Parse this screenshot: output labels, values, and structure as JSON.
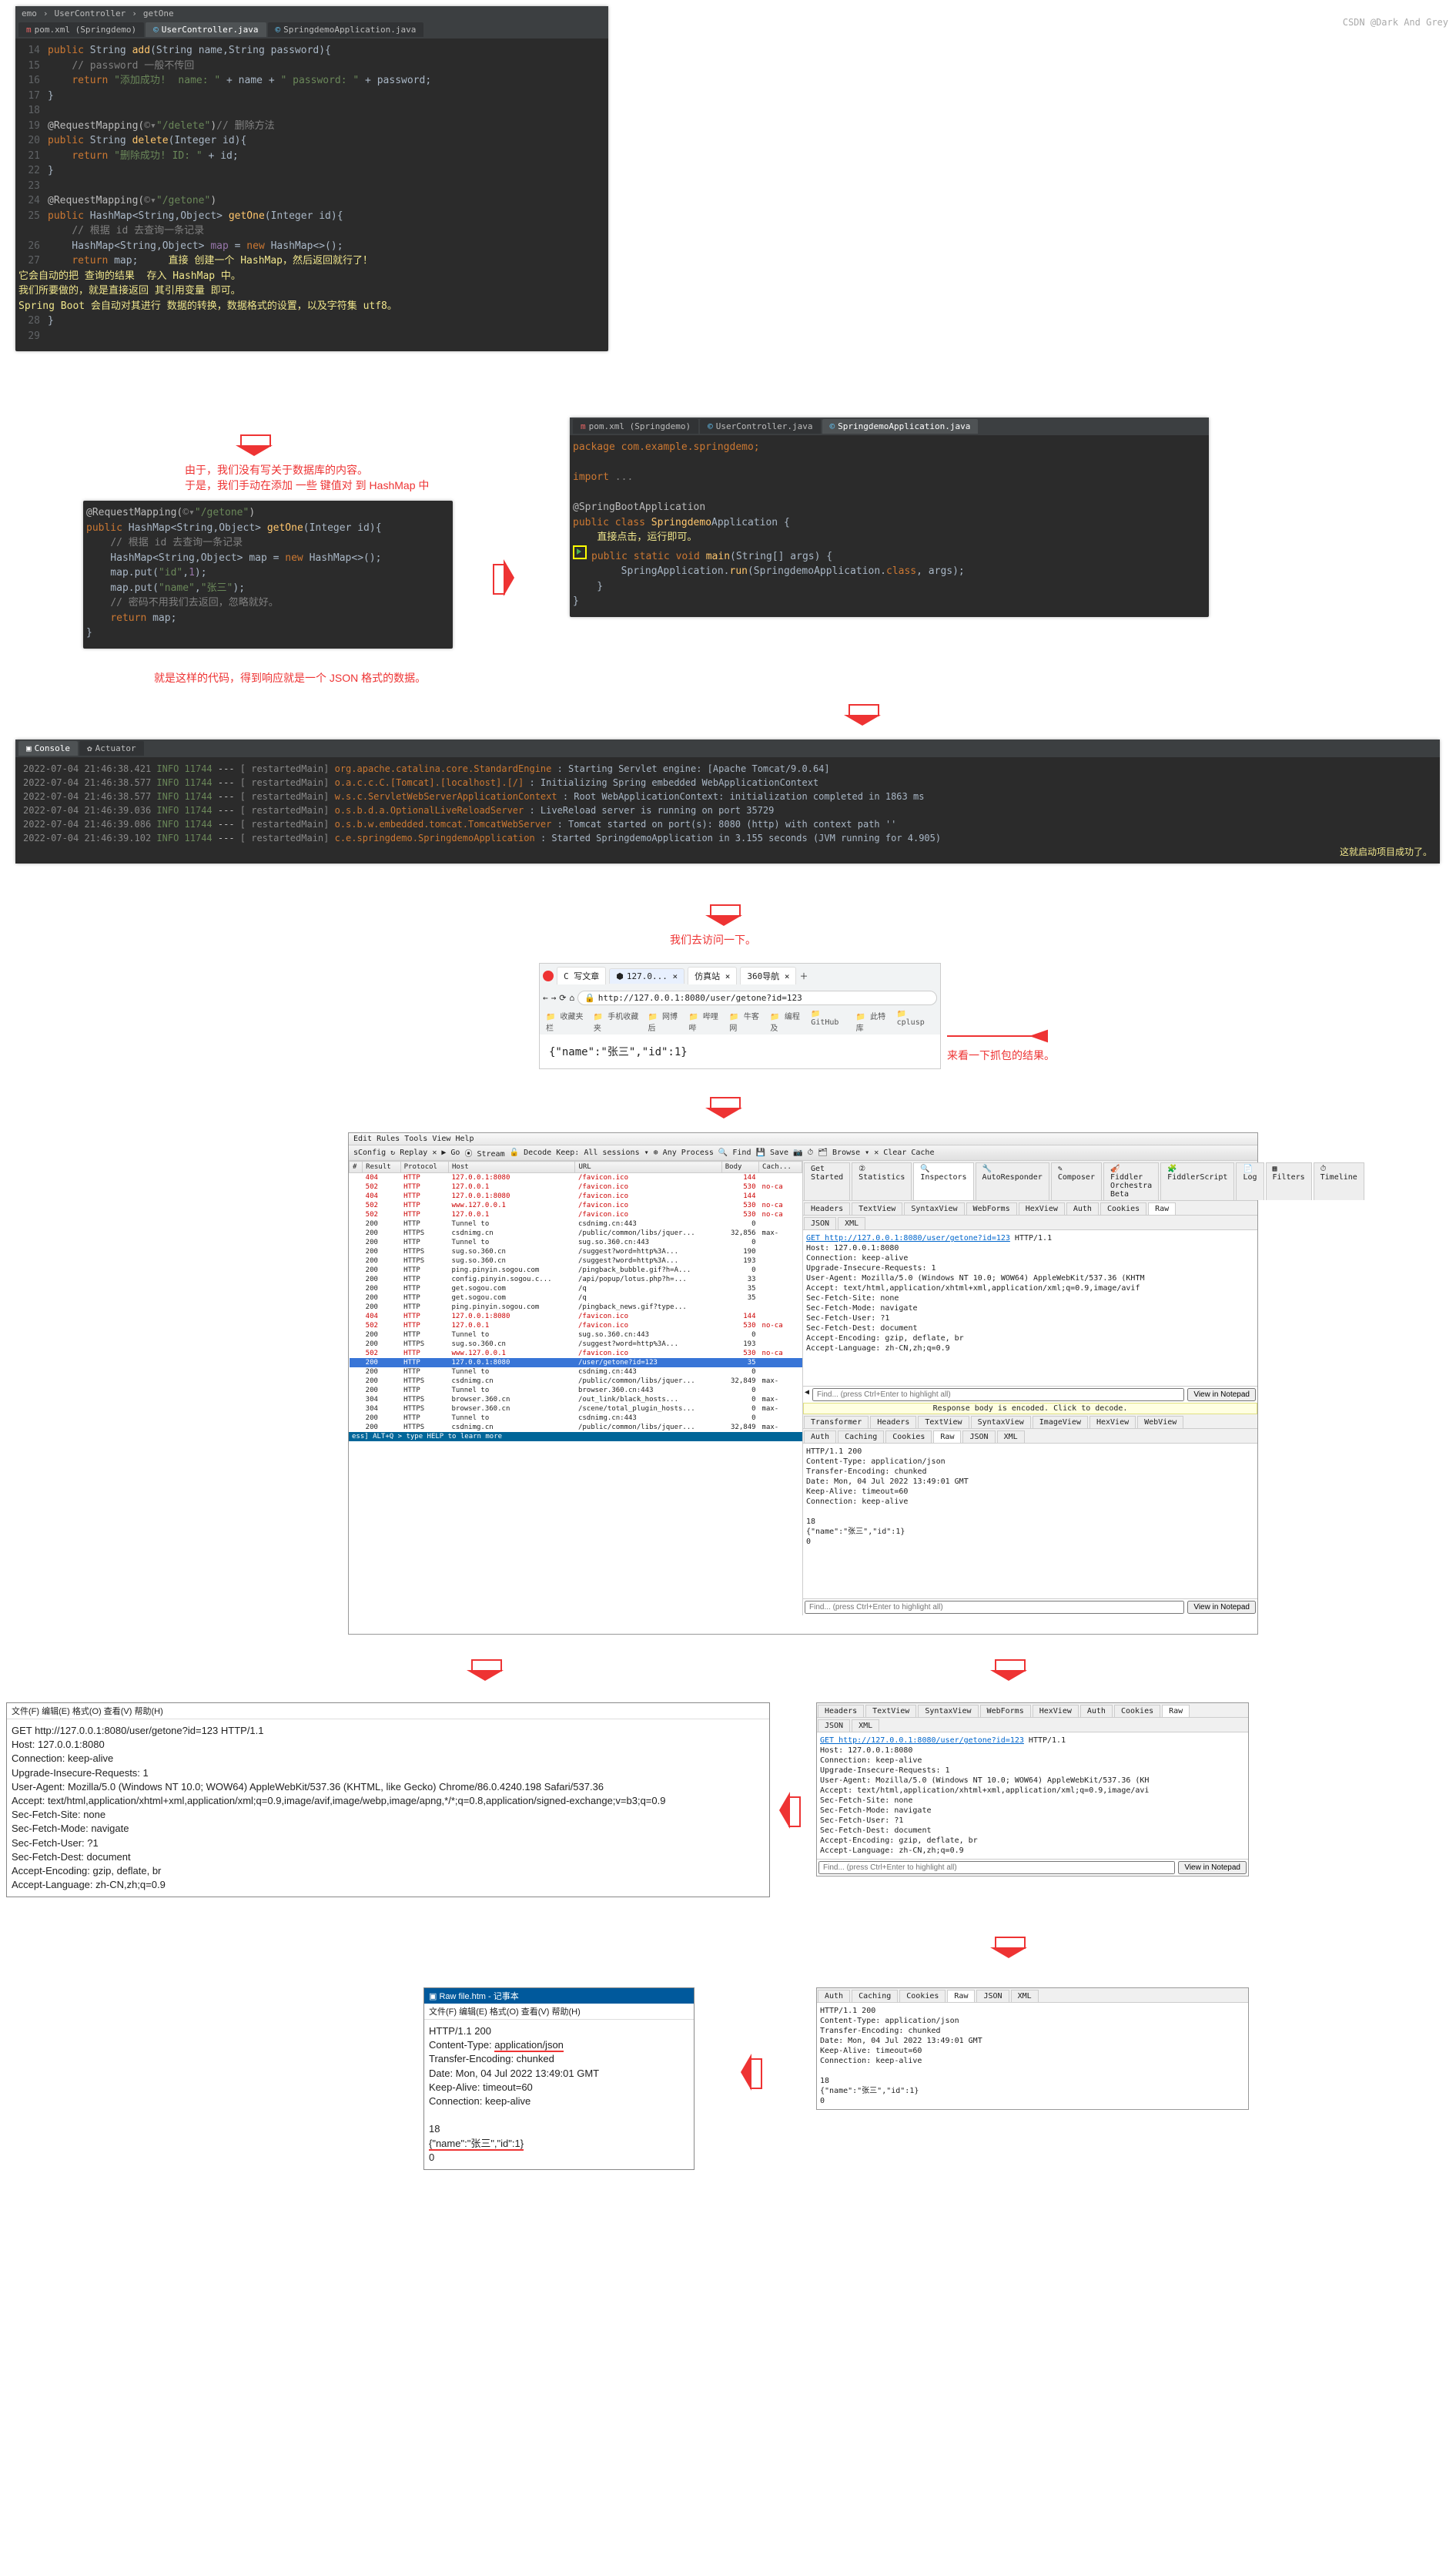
{
  "ide1": {
    "nav": [
      "emo",
      "UserController",
      "getOne"
    ],
    "tabs": [
      "pom.xml (Springdemo)",
      "UserController.java",
      "SpringdemoApplication.java"
    ],
    "lines": {
      "14": "    public String add(String name,String password){",
      "15": "        // password 一般不传回",
      "16": "        return \"添加成功!  name: \" + name + \" password: \" + password;",
      "17": "    }",
      "18": "",
      "19": "    @RequestMapping(©▾\"/delete\")// 删除方法",
      "20": "    public String delete(Integer id){",
      "21": "        return \"删除成功! ID: \" + id;",
      "22": "    }",
      "23": "",
      "24": "    @RequestMapping(©▾\"/getone\")",
      "25": "    public HashMap<String,Object> getOne(Integer id){",
      "25c": "        // 根据 id 去查询一条记录",
      "26": "        HashMap<String,Object> map = new HashMap<>();",
      "27": "        return map;",
      "28": "    }",
      "29": ""
    },
    "hint": "直接 创建一个 HashMap，然后返回就行了！\n它会自动的把 查询的结果  存入 HashMap 中。\n我们所要做的，就是直接返回 其引用变量 即可。\nSpring Boot 会自动对其进行 数据的转换，数据格式的设置，以及字符集 utf8。"
  },
  "note1": "由于，我们没有写关于数据库的内容。\n于是，我们手动在添加 一些 键值对 到 HashMap 中",
  "ide2": {
    "code": "@RequestMapping(©▾\"/getone\")\npublic HashMap<String,Object> getOne(Integer id){\n    // 根据 id 去查询一条记录\n    HashMap<String,Object> map = new HashMap<>();\n    map.put(\"id\",1);\n    map.put(\"name\",\"张三\");\n    // 密码不用我们去返回，忽略就好。\n    return map;\n}"
  },
  "note2": "就是这样的代码，得到响应就是一个 JSON 格式的数据。",
  "ide3": {
    "tabs": [
      "pom.xml (Springdemo)",
      "UserController.java",
      "SpringdemoApplication.java"
    ],
    "pkg": "package com.example.springdemo;",
    "imp": "import ...",
    "ann": "@SpringBootApplication",
    "cls": "public class SpringdemoApplication {",
    "hint": "直接点击，运行即可。",
    "main": "    public static void main(String[] args) {",
    "body": "        SpringApplication.run(SpringdemoApplication.class, args);",
    "end1": "    }",
    "end2": "}"
  },
  "console": {
    "tabs": [
      "Console",
      "Actuator"
    ],
    "rows": [
      {
        "ts": "2022-07-04 21:46:38.421",
        "lvl": "INFO 11744",
        "th": "[   restartedMain]",
        "cls": "org.apache.catalina.core.StandardEngine",
        "msg": ": Starting Servlet engine: [Apache Tomcat/9.0.64]"
      },
      {
        "ts": "2022-07-04 21:46:38.577",
        "lvl": "INFO 11744",
        "th": "[   restartedMain]",
        "cls": "o.a.c.c.C.[Tomcat].[localhost].[/]",
        "msg": ": Initializing Spring embedded WebApplicationContext"
      },
      {
        "ts": "2022-07-04 21:46:38.577",
        "lvl": "INFO 11744",
        "th": "[   restartedMain]",
        "cls": "w.s.c.ServletWebServerApplicationContext",
        "msg": ": Root WebApplicationContext: initialization completed in 1863 ms"
      },
      {
        "ts": "2022-07-04 21:46:39.036",
        "lvl": "INFO 11744",
        "th": "[   restartedMain]",
        "cls": "o.s.b.d.a.OptionalLiveReloadServer",
        "msg": ": LiveReload server is running on port 35729"
      },
      {
        "ts": "2022-07-04 21:46:39.086",
        "lvl": "INFO 11744",
        "th": "[   restartedMain]",
        "cls": "o.s.b.w.embedded.tomcat.TomcatWebServer",
        "msg": ": Tomcat started on port(s): 8080 (http) with context path ''"
      },
      {
        "ts": "2022-07-04 21:46:39.102",
        "lvl": "INFO 11744",
        "th": "[   restartedMain]",
        "cls": "c.e.springdemo.SpringdemoApplication",
        "msg": ": Started SpringdemoApplication in 3.155 seconds (JVM running for 4.905)"
      }
    ],
    "success": "这就启动项目成功了。"
  },
  "note3": "我们去访问一下。",
  "browser": {
    "tabs": [
      "C 写文章",
      "127.0... ×",
      "仿真站 ×",
      "360导航 ×"
    ],
    "url": "http://127.0.0.1:8080/user/getone?id=123",
    "bookmarks": [
      "收藏夹栏",
      "手机收藏夹",
      "网博后",
      "哔哩哔",
      "牛客网",
      "编程及",
      "GitHub",
      "此特库",
      "cplusp"
    ],
    "body": "{\"name\":\"张三\",\"id\":1}"
  },
  "note4": "来看一下抓包的结果。",
  "fiddler": {
    "menu": "Edit  Rules  Tools  View  Help",
    "tool": [
      "sConfig",
      "↻ Replay",
      "✕",
      "▶ Go",
      "⦿ Stream",
      "🔓 Decode",
      "Keep: All sessions ▾",
      "⊕ Any Process",
      "🔍 Find",
      "💾 Save",
      "📷",
      "⏱",
      "🗂 Browse ▾",
      "✕ Clear Cache"
    ],
    "cols": [
      "#",
      "Result",
      "Protocol",
      "Host",
      "URL",
      "Body",
      "Cach..."
    ],
    "rows": [
      {
        "n": "",
        "r": "404",
        "p": "HTTP",
        "h": "127.0.0.1:8080",
        "u": "/favicon.ico",
        "b": "144",
        "c": "",
        "err": true
      },
      {
        "n": "",
        "r": "502",
        "p": "HTTP",
        "h": "127.0.0.1",
        "u": "/favicon.ico",
        "b": "530",
        "c": "no-ca",
        "err": true
      },
      {
        "n": "",
        "r": "404",
        "p": "HTTP",
        "h": "127.0.0.1:8080",
        "u": "/favicon.ico",
        "b": "144",
        "c": "",
        "err": true
      },
      {
        "n": "",
        "r": "502",
        "p": "HTTP",
        "h": "www.127.0.0.1",
        "u": "/favicon.ico",
        "b": "530",
        "c": "no-ca",
        "err": true
      },
      {
        "n": "",
        "r": "502",
        "p": "HTTP",
        "h": "127.0.0.1",
        "u": "/favicon.ico",
        "b": "530",
        "c": "no-ca",
        "err": true
      },
      {
        "n": "",
        "r": "200",
        "p": "HTTP",
        "h": "Tunnel to",
        "u": "csdnimg.cn:443",
        "b": "0",
        "c": ""
      },
      {
        "n": "",
        "r": "200",
        "p": "HTTPS",
        "h": "csdnimg.cn",
        "u": "/public/common/libs/jquer...",
        "b": "32,856",
        "c": "max-"
      },
      {
        "n": "",
        "r": "200",
        "p": "HTTP",
        "h": "Tunnel to",
        "u": "sug.so.360.cn:443",
        "b": "0",
        "c": ""
      },
      {
        "n": "",
        "r": "200",
        "p": "HTTPS",
        "h": "sug.so.360.cn",
        "u": "/suggest?word=http%3A...",
        "b": "190",
        "c": ""
      },
      {
        "n": "",
        "r": "200",
        "p": "HTTPS",
        "h": "sug.so.360.cn",
        "u": "/suggest?word=http%3A...",
        "b": "193",
        "c": ""
      },
      {
        "n": "",
        "r": "200",
        "p": "HTTP",
        "h": "ping.pinyin.sogou.com",
        "u": "/pingback_bubble.gif?h=A...",
        "b": "0",
        "c": ""
      },
      {
        "n": "",
        "r": "200",
        "p": "HTTP",
        "h": "config.pinyin.sogou.c...",
        "u": "/api/popup/lotus.php?h=...",
        "b": "33",
        "c": ""
      },
      {
        "n": "",
        "r": "200",
        "p": "HTTP",
        "h": "get.sogou.com",
        "u": "/q",
        "b": "35",
        "c": ""
      },
      {
        "n": "",
        "r": "200",
        "p": "HTTP",
        "h": "get.sogou.com",
        "u": "/q",
        "b": "35",
        "c": ""
      },
      {
        "n": "",
        "r": "200",
        "p": "HTTP",
        "h": "ping.pinyin.sogou.com",
        "u": "/pingback_news.gif?type...",
        "b": "",
        "c": ""
      },
      {
        "n": "",
        "r": "404",
        "p": "HTTP",
        "h": "127.0.0.1:8080",
        "u": "/favicon.ico",
        "b": "144",
        "c": "",
        "err": true
      },
      {
        "n": "",
        "r": "502",
        "p": "HTTP",
        "h": "127.0.0.1",
        "u": "/favicon.ico",
        "b": "530",
        "c": "no-ca",
        "err": true
      },
      {
        "n": "",
        "r": "200",
        "p": "HTTP",
        "h": "Tunnel to",
        "u": "sug.so.360.cn:443",
        "b": "0",
        "c": ""
      },
      {
        "n": "",
        "r": "200",
        "p": "HTTPS",
        "h": "sug.so.360.cn",
        "u": "/suggest?word=http%3A...",
        "b": "193",
        "c": ""
      },
      {
        "n": "",
        "r": "502",
        "p": "HTTP",
        "h": "www.127.0.0.1",
        "u": "/favicon.ico",
        "b": "530",
        "c": "no-ca",
        "err": true
      },
      {
        "n": "",
        "r": "200",
        "p": "HTTP",
        "h": "127.0.0.1:8080",
        "u": "/user/getone?id=123",
        "b": "35",
        "c": "",
        "sel": true
      },
      {
        "n": "",
        "r": "200",
        "p": "HTTP",
        "h": "Tunnel to",
        "u": "csdnimg.cn:443",
        "b": "0",
        "c": ""
      },
      {
        "n": "",
        "r": "200",
        "p": "HTTPS",
        "h": "csdnimg.cn",
        "u": "/public/common/libs/jquer...",
        "b": "32,849",
        "c": "max-"
      },
      {
        "n": "",
        "r": "200",
        "p": "HTTP",
        "h": "Tunnel to",
        "u": "browser.360.cn:443",
        "b": "0",
        "c": ""
      },
      {
        "n": "",
        "r": "304",
        "p": "HTTPS",
        "h": "browser.360.cn",
        "u": "/out_link/black_hosts...",
        "b": "0",
        "c": "max-"
      },
      {
        "n": "",
        "r": "304",
        "p": "HTTPS",
        "h": "browser.360.cn",
        "u": "/scene/total_plugin_hosts...",
        "b": "0",
        "c": "max-"
      },
      {
        "n": "",
        "r": "200",
        "p": "HTTP",
        "h": "Tunnel to",
        "u": "csdnimg.cn:443",
        "b": "0",
        "c": ""
      },
      {
        "n": "",
        "r": "200",
        "p": "HTTPS",
        "h": "csdnimg.cn",
        "u": "/public/common/libs/jquer...",
        "b": "32,849",
        "c": "max-"
      }
    ],
    "status": "ess] ALT+Q > type HELP to learn more",
    "rightTop": {
      "tabs1": [
        "Get Started",
        "② Statistics",
        "🔍 Inspectors",
        "🔧 AutoResponder",
        "✎ Composer",
        "🎻 Fiddler Orchestra Beta",
        "🧩 FiddlerScript",
        "📄 Log",
        "▦ Filters",
        "⏱ Timeline"
      ],
      "tabs2": [
        "Headers",
        "TextView",
        "SyntaxView",
        "WebForms",
        "HexView",
        "Auth",
        "Cookies",
        "Raw"
      ],
      "tabs3": [
        "JSON",
        "XML"
      ],
      "raw": "GET http://127.0.0.1:8080/user/getone?id=123 HTTP/1.1\nHost: 127.0.0.1:8080\nConnection: keep-alive\nUpgrade-Insecure-Requests: 1\nUser-Agent: Mozilla/5.0 (Windows NT 10.0; WOW64) AppleWebKit/537.36 (KHTM\nAccept: text/html,application/xhtml+xml,application/xml;q=0.9,image/avif\nSec-Fetch-Site: none\nSec-Fetch-Mode: navigate\nSec-Fetch-User: ?1\nSec-Fetch-Dest: document\nAccept-Encoding: gzip, deflate, br\nAccept-Language: zh-CN,zh;q=0.9",
      "find": "Find... (press Ctrl+Enter to highlight all)",
      "btn": "View in Notepad"
    },
    "rightBot": {
      "decode": "Response body is encoded. Click to decode.",
      "tabs1": [
        "Transformer",
        "Headers",
        "TextView",
        "SyntaxView",
        "ImageView",
        "HexView",
        "WebView"
      ],
      "tabs2": [
        "Auth",
        "Caching",
        "Cookies",
        "Raw",
        "JSON",
        "XML"
      ],
      "raw": "HTTP/1.1 200\nContent-Type: application/json\nTransfer-Encoding: chunked\nDate: Mon, 04 Jul 2022 13:49:01 GMT\nKeep-Alive: timeout=60\nConnection: keep-alive\n\n18\n{\"name\":\"张三\",\"id\":1}\n0",
      "find": "Find... (press Ctrl+Enter to highlight all)",
      "btn": "View in Notepad"
    }
  },
  "notepad1": {
    "menu": "文件(F)  编辑(E)  格式(O)  查看(V)  帮助(H)",
    "body": "GET http://127.0.0.1:8080/user/getone?id=123 HTTP/1.1\nHost: 127.0.0.1:8080\nConnection: keep-alive\nUpgrade-Insecure-Requests: 1\nUser-Agent: Mozilla/5.0 (Windows NT 10.0; WOW64) AppleWebKit/537.36 (KHTML, like Gecko) Chrome/86.0.4240.198 Safari/537.36\nAccept: text/html,application/xhtml+xml,application/xml;q=0.9,image/avif,image/webp,image/apng,*/*;q=0.8,application/signed-exchange;v=b3;q=0.9\nSec-Fetch-Site: none\nSec-Fetch-Mode: navigate\nSec-Fetch-User: ?1\nSec-Fetch-Dest: document\nAccept-Encoding: gzip, deflate, br\nAccept-Language: zh-CN,zh;q=0.9"
  },
  "mini_req": {
    "tabs": [
      "Headers",
      "TextView",
      "SyntaxView",
      "WebForms",
      "HexView",
      "Auth",
      "Cookies",
      "Raw"
    ],
    "sub": [
      "JSON",
      "XML"
    ],
    "raw": "GET http://127.0.0.1:8080/user/getone?id=123 HTTP/1.1\nHost: 127.0.0.1:8080\nConnection: keep-alive\nUpgrade-Insecure-Requests: 1\nUser-Agent: Mozilla/5.0 (Windows NT 10.0; WOW64) AppleWebKit/537.36 (KH\nAccept: text/html,application/xhtml+xml,application/xml;q=0.9,image/avi\nSec-Fetch-Site: none\nSec-Fetch-Mode: navigate\nSec-Fetch-User: ?1\nSec-Fetch-Dest: document\nAccept-Encoding: gzip, deflate, br\nAccept-Language: zh-CN,zh;q=0.9",
    "find": "Find... (press Ctrl+Enter to highlight all)",
    "btn": "View in Notepad"
  },
  "notepad2": {
    "menu": "文件(F)  编辑(E)  格式(O)  查看(V)  帮助(H)",
    "l1": "HTTP/1.1 200",
    "l2a": "Content-Type: ",
    "l2b": "application/json",
    "l3": "Transfer-Encoding: chunked",
    "l4": "Date: Mon, 04 Jul 2022 13:49:01 GMT",
    "l5": "Keep-Alive: timeout=60",
    "l6": "Connection: keep-alive",
    "l7": "",
    "l8": "18",
    "l9": "{\"name\":\"张三\",\"id\":1}",
    "l10": "0"
  },
  "mini_resp": {
    "tabs": [
      "Auth",
      "Caching",
      "Cookies",
      "Raw",
      "JSON",
      "XML"
    ],
    "raw": "HTTP/1.1 200\nContent-Type: application/json\nTransfer-Encoding: chunked\nDate: Mon, 04 Jul 2022 13:49:01 GMT\nKeep-Alive: timeout=60\nConnection: keep-alive\n\n18\n{\"name\":\"张三\",\"id\":1}\n0"
  },
  "footer": "CSDN @Dark And Grey"
}
